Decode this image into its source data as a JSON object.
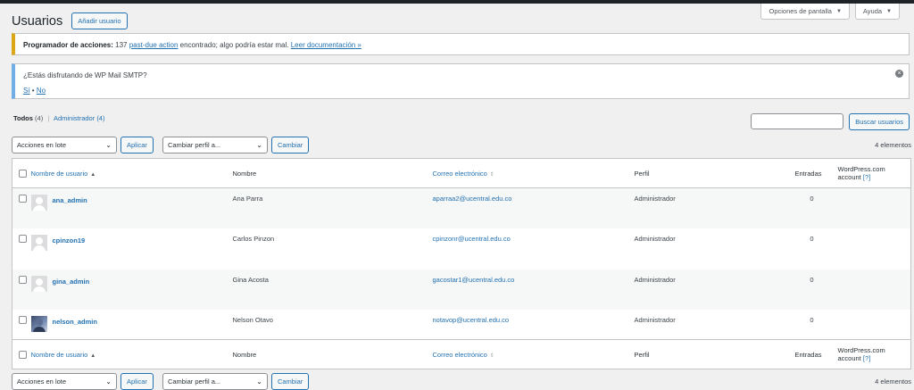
{
  "screen_options": {
    "screen_label": "Opciones de pantalla",
    "help_label": "Ayuda"
  },
  "header": {
    "title": "Usuarios",
    "add_user": "Añadir usuario"
  },
  "notice_warning": {
    "bold": "Programador de acciones:",
    "text_before": " 137 ",
    "link1": "past-due action",
    "text_after": " encontrado; algo podría estar mal. ",
    "link2": "Leer documentación »"
  },
  "notice_info": {
    "question": "¿Estás disfrutando de WP Mail SMTP?",
    "yes": "Sí",
    "sep": " • ",
    "no": "No"
  },
  "views": {
    "all_label": "Todos",
    "all_count": "(4)",
    "sep": "|",
    "admin_label": "Administrador",
    "admin_count": "(4)"
  },
  "search": {
    "value": "",
    "button": "Buscar usuarios"
  },
  "tablenav": {
    "bulk_action": "Acciones en lote",
    "apply": "Aplicar",
    "change_role": "Cambiar perfil a...",
    "change": "Cambiar",
    "items": "4 elementos"
  },
  "columns": {
    "username": "Nombre de usuario",
    "name": "Nombre",
    "email": "Correo electrónico",
    "role": "Perfil",
    "posts": "Entradas",
    "wpcom_line1": "WordPress.com",
    "wpcom_line2": "account",
    "wpcom_help": "[?]"
  },
  "users": [
    {
      "username": "ana_admin",
      "name": "Ana Parra",
      "email": "aparraa2@ucentral.edu.co",
      "role": "Administrador",
      "posts": "0"
    },
    {
      "username": "cpinzon19",
      "name": "Carlos Pinzon",
      "email": "cpinzonr@ucentral.edu.co",
      "role": "Administrador",
      "posts": "0"
    },
    {
      "username": "gina_admin",
      "name": "Gina Acosta",
      "email": "gacostar1@ucentral.edu.co",
      "role": "Administrador",
      "posts": "0"
    },
    {
      "username": "nelson_admin",
      "name": "Nelson Otavo",
      "email": "notavop@ucentral.edu.co",
      "role": "Administrador",
      "posts": "0"
    }
  ],
  "colors": {
    "accent": "#2271b1",
    "warning": "#dba617",
    "info": "#72aee6",
    "adminbar": "#1d2327"
  }
}
